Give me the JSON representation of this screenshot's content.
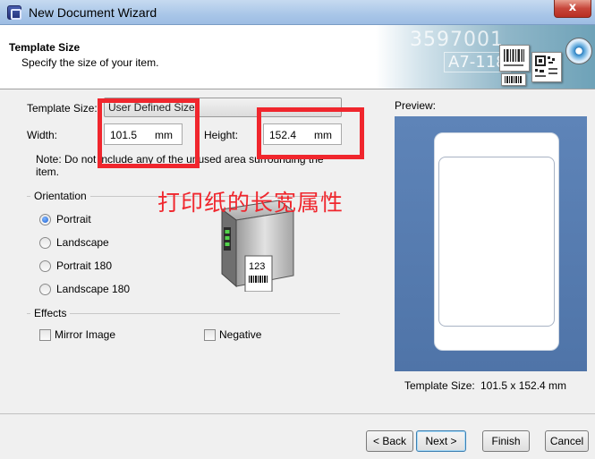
{
  "window": {
    "title": "New Document Wizard",
    "close_glyph": "x"
  },
  "header": {
    "title": "Template Size",
    "subtitle": "Specify the size of your item.",
    "banner_text_1": "3597001",
    "banner_text_2": "A7-118"
  },
  "template_size": {
    "label": "Template Size:",
    "value": "User Defined Size"
  },
  "width": {
    "label": "Width:",
    "value": "101.5",
    "unit": "mm"
  },
  "height": {
    "label": "Height:",
    "value": "152.4",
    "unit": "mm"
  },
  "note": "Note: Do not include any of the unused area surrounding the item.",
  "orientation": {
    "heading": "Orientation",
    "options": [
      "Portrait",
      "Landscape",
      "Portrait 180",
      "Landscape 180"
    ],
    "selected": "Portrait"
  },
  "printer": {
    "label_text": "123"
  },
  "effects": {
    "heading": "Effects",
    "mirror_image": "Mirror Image",
    "negative": "Negative"
  },
  "preview": {
    "label": "Preview:",
    "template_size_label": "Template Size:",
    "template_size_value": "101.5 x 152.4 mm"
  },
  "annotation": {
    "text": "打印纸的长宽属性",
    "color": "#f0262d"
  },
  "buttons": {
    "back": "< Back",
    "next": "Next >",
    "finish": "Finish",
    "cancel": "Cancel"
  }
}
